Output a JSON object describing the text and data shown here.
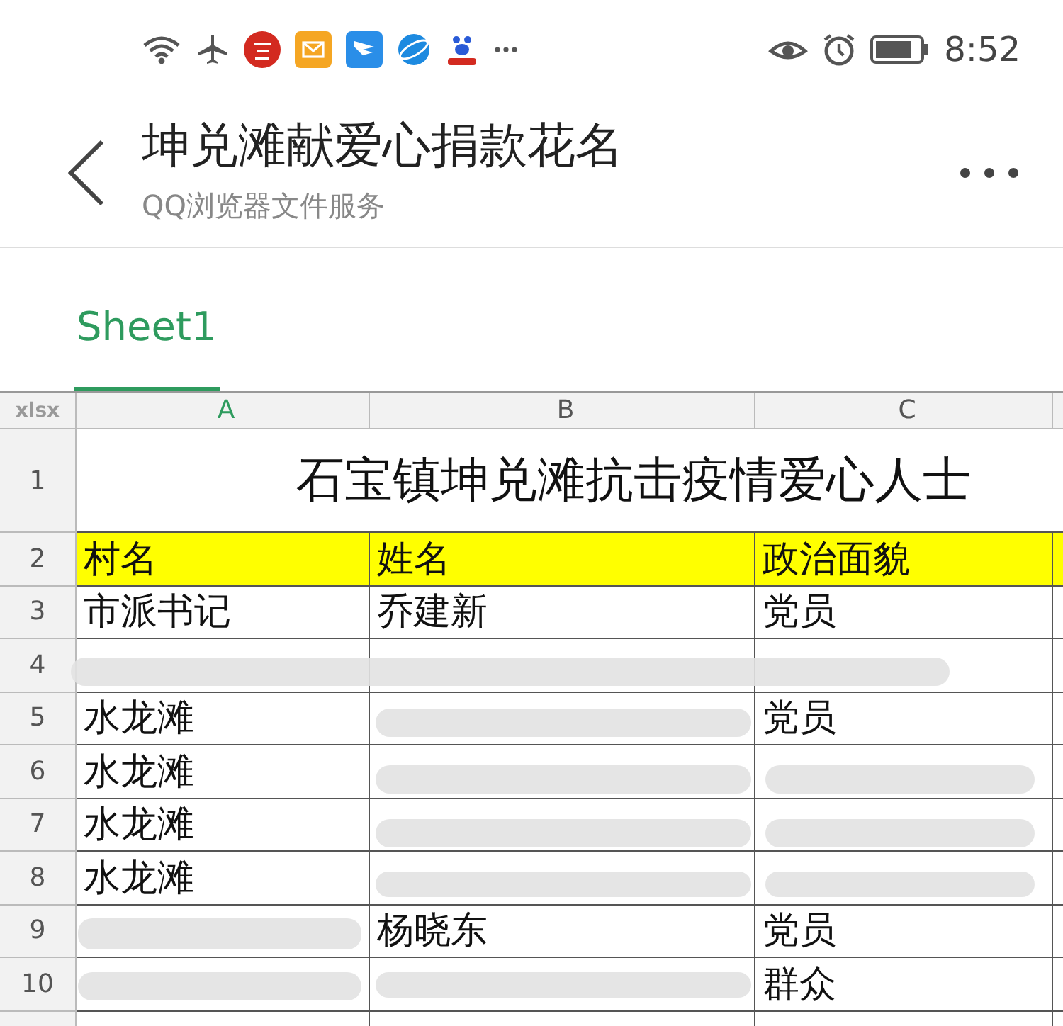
{
  "status_bar": {
    "time": "8:52"
  },
  "header": {
    "title": "坤兑滩献爱心捐款花名",
    "subtitle": "QQ浏览器文件服务"
  },
  "tabs": [
    {
      "label": "Sheet1",
      "selected": true
    }
  ],
  "sheet": {
    "corner": "xlsx",
    "columns": [
      {
        "label": "A",
        "selected": true
      },
      {
        "label": "B",
        "selected": false
      },
      {
        "label": "C",
        "selected": false
      }
    ],
    "title_row": {
      "number": "1",
      "text": "石宝镇坤兑滩抗击疫情爱心人士"
    },
    "header_row": {
      "number": "2",
      "cells": [
        "村名",
        "姓名",
        "政治面貌"
      ]
    },
    "rows": [
      {
        "number": "3",
        "cells": [
          "市派书记",
          "乔建新",
          "党员"
        ]
      },
      {
        "number": "4",
        "cells": [
          "",
          "",
          ""
        ]
      },
      {
        "number": "5",
        "cells": [
          "水龙滩",
          "",
          "党员"
        ]
      },
      {
        "number": "6",
        "cells": [
          "水龙滩",
          "",
          ""
        ]
      },
      {
        "number": "7",
        "cells": [
          "水龙滩",
          "",
          ""
        ]
      },
      {
        "number": "8",
        "cells": [
          "水龙滩",
          "",
          ""
        ]
      },
      {
        "number": "9",
        "cells": [
          "",
          "杨晓东",
          "党员"
        ]
      },
      {
        "number": "10",
        "cells": [
          "",
          "",
          "群众"
        ]
      },
      {
        "cells": [
          "",
          "",
          ""
        ]
      }
    ]
  }
}
